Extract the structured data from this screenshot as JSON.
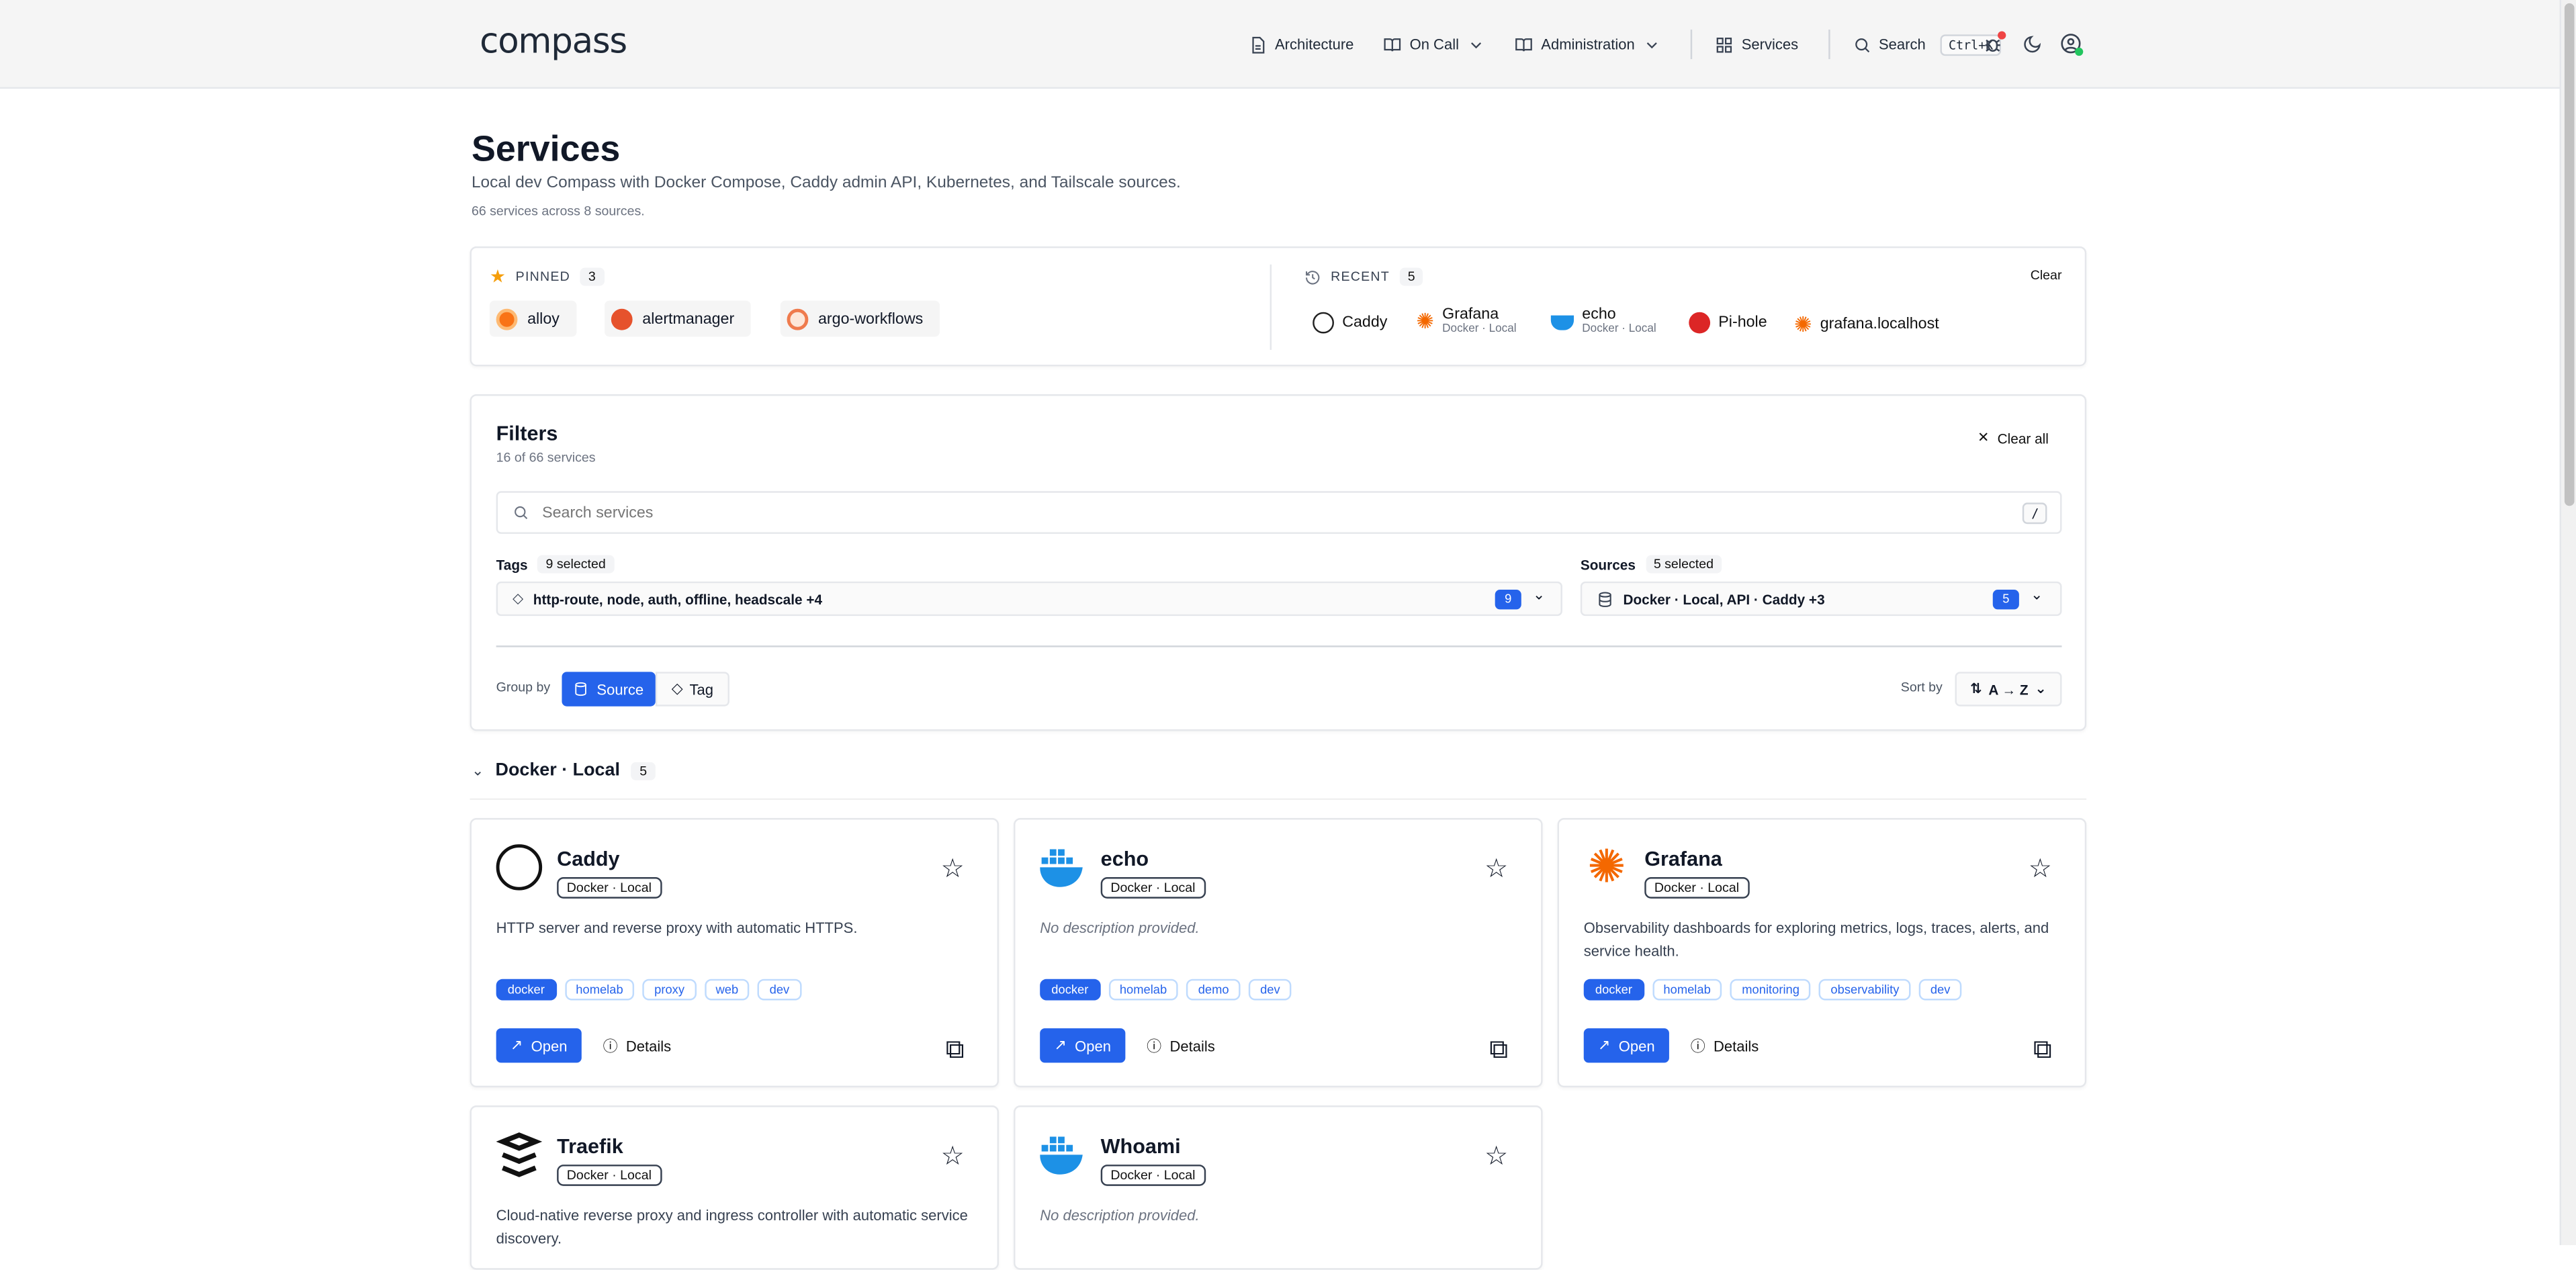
{
  "brand": "compass",
  "nav": {
    "architecture": "Architecture",
    "oncall": "On Call",
    "administration": "Administration",
    "services": "Services",
    "search": "Search",
    "search_shortcut": "Ctrl+K"
  },
  "page": {
    "title": "Services",
    "subtitle": "Local dev Compass with Docker Compose, Caddy admin API, Kubernetes, and Tailscale sources.",
    "count": "66 services across 8 sources."
  },
  "pinned": {
    "label": "PINNED",
    "count": "3",
    "items": [
      {
        "name": "alloy",
        "color": "#f97316"
      },
      {
        "name": "alertmanager",
        "color": "#e6522c"
      },
      {
        "name": "argo-workflows",
        "color": "#ef7b4d"
      }
    ]
  },
  "recent": {
    "label": "RECENT",
    "count": "5",
    "clear": "Clear",
    "items": [
      {
        "name": "Caddy",
        "source": ""
      },
      {
        "name": "Grafana",
        "source": "Docker · Local"
      },
      {
        "name": "echo",
        "source": "Docker · Local"
      },
      {
        "name": "Pi-hole",
        "source": ""
      },
      {
        "name": "grafana.localhost",
        "source": ""
      }
    ]
  },
  "filters": {
    "title": "Filters",
    "summary": "16 of 66 services",
    "clear_all": "Clear all",
    "search_placeholder": "Search services",
    "search_key": "/",
    "tags_label": "Tags",
    "tags_selected": "9 selected",
    "tags_value": "http-route, node, auth, offline, headscale +4",
    "tags_count": "9",
    "sources_label": "Sources",
    "sources_selected": "5 selected",
    "sources_value": "Docker · Local, API · Caddy +3",
    "sources_count": "5",
    "group_by_label": "Group by",
    "group_source": "Source",
    "group_tag": "Tag",
    "sort_label": "Sort by",
    "sort_value": "A → Z"
  },
  "group": {
    "name": "Docker · Local",
    "count": "5"
  },
  "cards": [
    {
      "name": "Caddy",
      "source": "Docker · Local",
      "desc": "HTTP server and reverse proxy with automatic HTTPS.",
      "tags": [
        "docker",
        "homelab",
        "proxy",
        "web",
        "dev"
      ],
      "open": "Open",
      "details": "Details"
    },
    {
      "name": "echo",
      "source": "Docker · Local",
      "desc": "No description provided.",
      "tags": [
        "docker",
        "homelab",
        "demo",
        "dev"
      ],
      "open": "Open",
      "details": "Details"
    },
    {
      "name": "Grafana",
      "source": "Docker · Local",
      "desc": "Observability dashboards for exploring metrics, logs, traces, alerts, and service health.",
      "tags": [
        "docker",
        "homelab",
        "monitoring",
        "observability",
        "dev"
      ],
      "open": "Open",
      "details": "Details"
    },
    {
      "name": "Traefik",
      "source": "Docker · Local",
      "desc": "Cloud-native reverse proxy and ingress controller with automatic service discovery."
    },
    {
      "name": "Whoami",
      "source": "Docker · Local",
      "desc": "No description provided."
    }
  ],
  "colors": {
    "accent": "#2563eb",
    "docker": "#1d91e6",
    "grafana": "#f46800"
  }
}
